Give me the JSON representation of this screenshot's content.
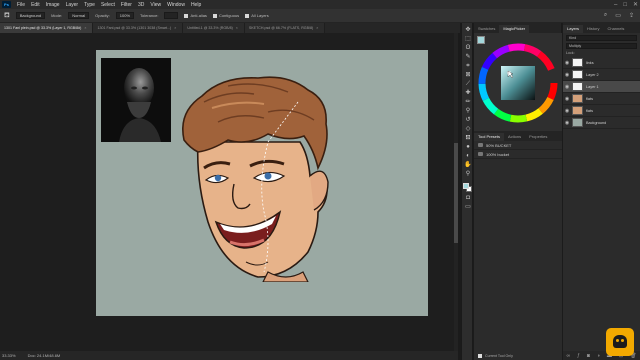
{
  "app": {
    "menu": [
      "File",
      "Edit",
      "Image",
      "Layer",
      "Type",
      "Select",
      "Filter",
      "3D",
      "View",
      "Window",
      "Help"
    ]
  },
  "options": {
    "preset": "Background",
    "mode_label": "Mode:",
    "mode_value": "Normal",
    "opacity_label": "Opacity:",
    "opacity_value": "100%",
    "tolerance_label": "Tolerance:",
    "anti_alias": "Anti-alias",
    "contiguous": "Contiguous",
    "all_layers": "All Layers"
  },
  "tabs": [
    {
      "label": "1301 Fanl plein.psd @ 33.3% (Layer 1, RGB/8#)",
      "active": true
    },
    {
      "label": "1301 Fanl.psd @ 33.3% (1301 3038 (Smart...)",
      "active": false
    },
    {
      "label": "Untitled-1 @ 33.3% (RGB/8)",
      "active": false
    },
    {
      "label": "SKETCH.psd @ 66.7% (FLATS, RGB/8)",
      "active": false
    }
  ],
  "status": {
    "zoom": "33.33%",
    "doc": "Doc: 24.1M/48.6M"
  },
  "color_panel": {
    "tabs": [
      "Swatches",
      "MagicPicker"
    ],
    "active_tab": "MagicPicker",
    "foreground": "#a4d8dc",
    "background": "#ffffff"
  },
  "tool_presets": {
    "tabs": [
      "Tool Presets",
      "Actions",
      "Properties"
    ],
    "items": [
      "50% BUCKET",
      "100% bucket"
    ],
    "current_tool_only": "Current Tool Only"
  },
  "layers": {
    "tabs": [
      "Layers",
      "History",
      "Channels"
    ],
    "kind_filter": "Kind",
    "blend_mode": "Multiply",
    "opacity": "Opacity: 100%",
    "fill": "Fill: 100%",
    "lock": "Lock:",
    "items": [
      {
        "name": "links",
        "selected": false,
        "thumb": "#f4f4f4"
      },
      {
        "name": "Layer 2",
        "selected": false,
        "thumb": "#f4f4f4"
      },
      {
        "name": "Layer 1",
        "selected": true,
        "thumb": "#f4f4f4"
      },
      {
        "name": "flats",
        "selected": false,
        "thumb": "#d4a07a"
      },
      {
        "name": "flats",
        "selected": false,
        "thumb": "#d4a07a"
      },
      {
        "name": "Background",
        "selected": false,
        "thumb": "#9aa9a3"
      }
    ]
  }
}
